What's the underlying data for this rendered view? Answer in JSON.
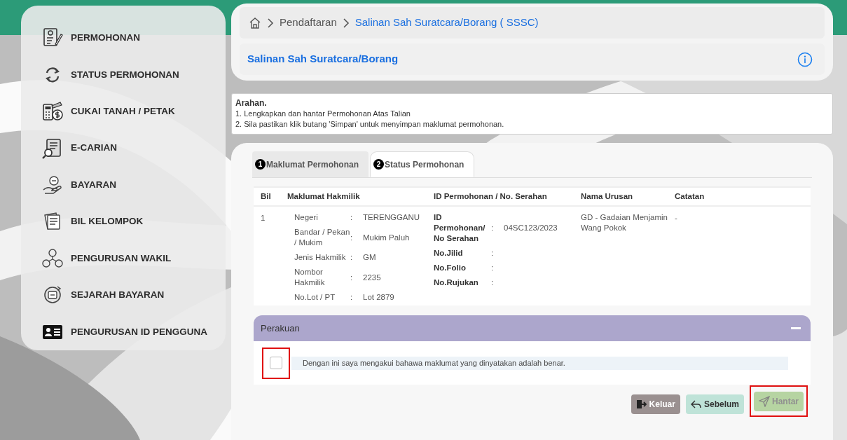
{
  "sidebar": {
    "items": [
      {
        "label": "PERMOHONAN",
        "kind": "form"
      },
      {
        "label": "STATUS PERMOHONAN",
        "kind": "refresh"
      },
      {
        "label": "CUKAI TANAH / PETAK",
        "kind": "calculator"
      },
      {
        "label": "E-CARIAN",
        "kind": "search"
      },
      {
        "label": "BAYARAN",
        "kind": "hand"
      },
      {
        "label": "BIL KELOMPOK",
        "kind": "bills"
      },
      {
        "label": "PENGURUSAN WAKIL",
        "kind": "people"
      },
      {
        "label": "SEJARAH BAYARAN",
        "kind": "history"
      },
      {
        "label": "PENGURUSAN ID PENGGUNA",
        "kind": "idcard"
      }
    ]
  },
  "breadcrumb": [
    {
      "label": "Pendaftaran",
      "current": false
    },
    {
      "label": "Salinan Sah Suratcara/Borang ( SSSC)",
      "current": true
    }
  ],
  "page_title": "Salinan Sah Suratcara/Borang",
  "instructions": {
    "title": "Arahan.",
    "lines": [
      "1. Lengkapkan dan hantar Permohonan Atas Talian",
      "2. Sila pastikan klik butang 'Simpan' untuk menyimpan maklumat permohonan."
    ]
  },
  "tabs": [
    {
      "number": "1",
      "label": "Maklumat Permohonan",
      "selected": false
    },
    {
      "number": "2",
      "label": "Status Permohonan",
      "selected": true
    }
  ],
  "table": {
    "columns": [
      "Bil",
      "Maklumat Hakmilik",
      "ID Permohonan / No. Serahan",
      "Nama Urusan",
      "Catatan"
    ],
    "rows": [
      {
        "bil": "1",
        "hakmilik": [
          {
            "label": "Negeri",
            "separator": ":",
            "value": "TERENGGANU"
          },
          {
            "label": "Bandar / Pekan / Mukim",
            "separator": ":",
            "value": "Mukim Paluh"
          },
          {
            "label": "Jenis Hakmilik",
            "separator": ":",
            "value": "GM"
          },
          {
            "label": "Nombor Hakmilik",
            "separator": ":",
            "value": "2235"
          },
          {
            "label": "No.Lot / PT",
            "separator": ":",
            "value": "Lot 2879"
          }
        ],
        "permohonan": [
          {
            "label": "ID Permohonan/ No Serahan",
            "separator": ":",
            "value": "04SC123/2023"
          },
          {
            "label": "No.Jilid",
            "separator": ":"
          },
          {
            "label": "No.Folio",
            "separator": ":"
          },
          {
            "label": "No.Rujukan",
            "separator": ":"
          }
        ],
        "nama_urusan": "GD - Gadaian Menjamin Wang Pokok",
        "catatan": "-"
      }
    ]
  },
  "declaration": {
    "title": "Perakuan",
    "expanded": true,
    "text": "Dengan ini saya mengakui bahawa maklumat yang dinyatakan adalah benar.",
    "checked": false,
    "highlighted": true
  },
  "buttons": [
    {
      "kind": "exit",
      "label": "Keluar",
      "disabled": false,
      "highlighted": false
    },
    {
      "kind": "back",
      "label": "Sebelum",
      "disabled": false,
      "highlighted": false
    },
    {
      "kind": "send",
      "label": "Hantar",
      "disabled": true,
      "highlighted": true
    }
  ]
}
